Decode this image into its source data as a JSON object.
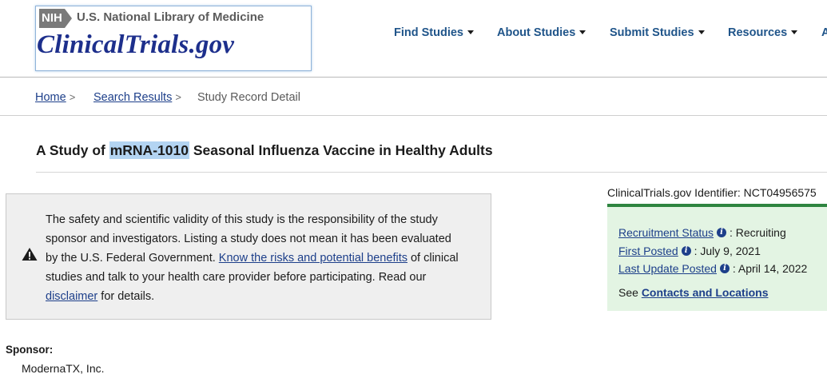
{
  "header": {
    "nih_badge": "NIH",
    "nlm_text": "U.S. National Library of Medicine",
    "logo_text": "ClinicalTrials.gov"
  },
  "nav": {
    "items": [
      {
        "label": "Find Studies"
      },
      {
        "label": "About Studies"
      },
      {
        "label": "Submit Studies"
      },
      {
        "label": "Resources"
      },
      {
        "label": "A"
      }
    ]
  },
  "breadcrumb": {
    "home": "Home",
    "search_results": "Search Results",
    "current": "Study Record Detail",
    "separator": ">"
  },
  "study": {
    "title_prefix": "A Study of ",
    "title_highlight": "mRNA-1010",
    "title_suffix": " Seasonal Influenza Vaccine in Healthy Adults"
  },
  "disclaimer": {
    "text_1": "The safety and scientific validity of this study is the responsibility of the study sponsor and investigators. Listing a study does not mean it has been evaluated by the U.S. Federal Government. ",
    "risks_link": "Know the risks and potential benefits",
    "text_2": " of clinical studies and talk to your health care provider before participating. Read our ",
    "disclaimer_link": "disclaimer",
    "text_3": " for details."
  },
  "record": {
    "identifier_label": "ClinicalTrials.gov Identifier: ",
    "identifier_value": "NCT04956575",
    "recruitment_status_label": "Recruitment Status",
    "recruitment_status_value": " : Recruiting",
    "first_posted_label": "First Posted",
    "first_posted_value": " : July 9, 2021",
    "last_update_label": "Last Update Posted",
    "last_update_value": " : April 14, 2022",
    "see_prefix": "See ",
    "contacts_link": "Contacts and Locations"
  },
  "sponsor": {
    "label": "Sponsor:",
    "value": "ModernaTX, Inc."
  },
  "icons": {
    "warning": "warning-triangle-icon",
    "info": "info-circle-icon",
    "info_glyph": "i"
  },
  "colors": {
    "nav_link": "#20558a",
    "link": "#1d3f8a",
    "logo": "#1d2f8c",
    "status_bg": "#e3f4e3",
    "status_border": "#2e8540",
    "highlight": "#b3d4f2",
    "disclaimer_bg": "#efefef"
  }
}
